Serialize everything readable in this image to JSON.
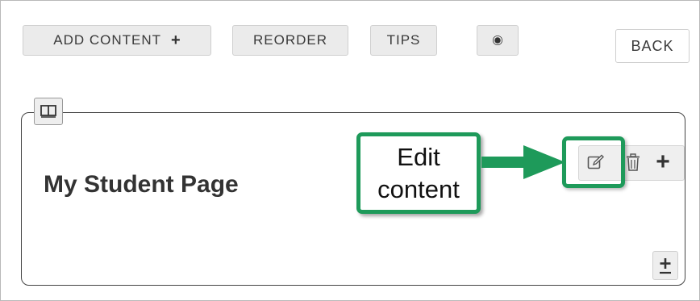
{
  "toolbar": {
    "add_content_label": "ADD CONTENT",
    "add_content_icon": "plus-icon",
    "reorder_label": "REORDER",
    "tips_label": "TIPS",
    "settings_icon": "gear-icon",
    "back_label": "BACK"
  },
  "page_block": {
    "layout_icon": "columns-layout-icon",
    "heading": "My Student Page",
    "tools": {
      "edit_icon": "edit-icon",
      "delete_icon": "trash-icon",
      "add_icon": "plus-icon"
    },
    "add_below_icon": "plus-underline-icon"
  },
  "annotation": {
    "callout_line1": "Edit",
    "callout_line2": "content",
    "accent_color": "#1e9a5a"
  }
}
